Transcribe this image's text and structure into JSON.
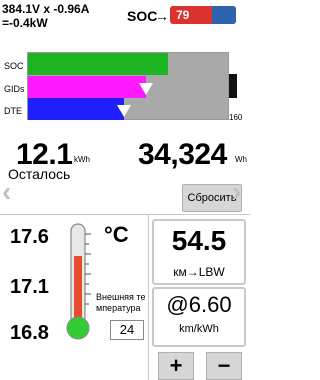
{
  "status": {
    "voltage_current": "384.1V x -0.96A",
    "power": "=-0.4kW",
    "soc_label": "SOC",
    "soc_arrow": "→",
    "soc_value": "79"
  },
  "gauges": {
    "labels": [
      "SOC",
      "GIDs",
      "DTE"
    ],
    "max_label": "160",
    "soc_fraction": 0.7,
    "gids_fraction": 0.59,
    "dte_fraction": 0.48,
    "colors": {
      "soc": "#1fb421",
      "gids": "#ff19ff",
      "dte": "#2020ff",
      "empty": "#a9a9a9"
    }
  },
  "energy": {
    "kwh_value": "12.1",
    "kwh_unit": "kWh",
    "wh_value": "34,324",
    "wh_unit": "Wh",
    "remaining_label": "Осталось",
    "reset_label": "Сбросить"
  },
  "nav": {
    "prev_icon": "chevron-left-icon",
    "next_icon": "chevron-right-icon",
    "prev": "‹",
    "next": "›"
  },
  "temperature": {
    "values": [
      "17.6",
      "17.1",
      "16.8"
    ],
    "unit": "°C",
    "outside_label": "Внешняя температура",
    "outside_label_line1": "Внешняя те",
    "outside_label_line2": "мпература",
    "outside_value": "24",
    "thermometer_fill": 0.68
  },
  "range": {
    "value": "54.5",
    "unit": "км→LBW",
    "efficiency": "@6.60",
    "efficiency_unit": "km/kWh",
    "plus": "+",
    "minus": "−"
  }
}
